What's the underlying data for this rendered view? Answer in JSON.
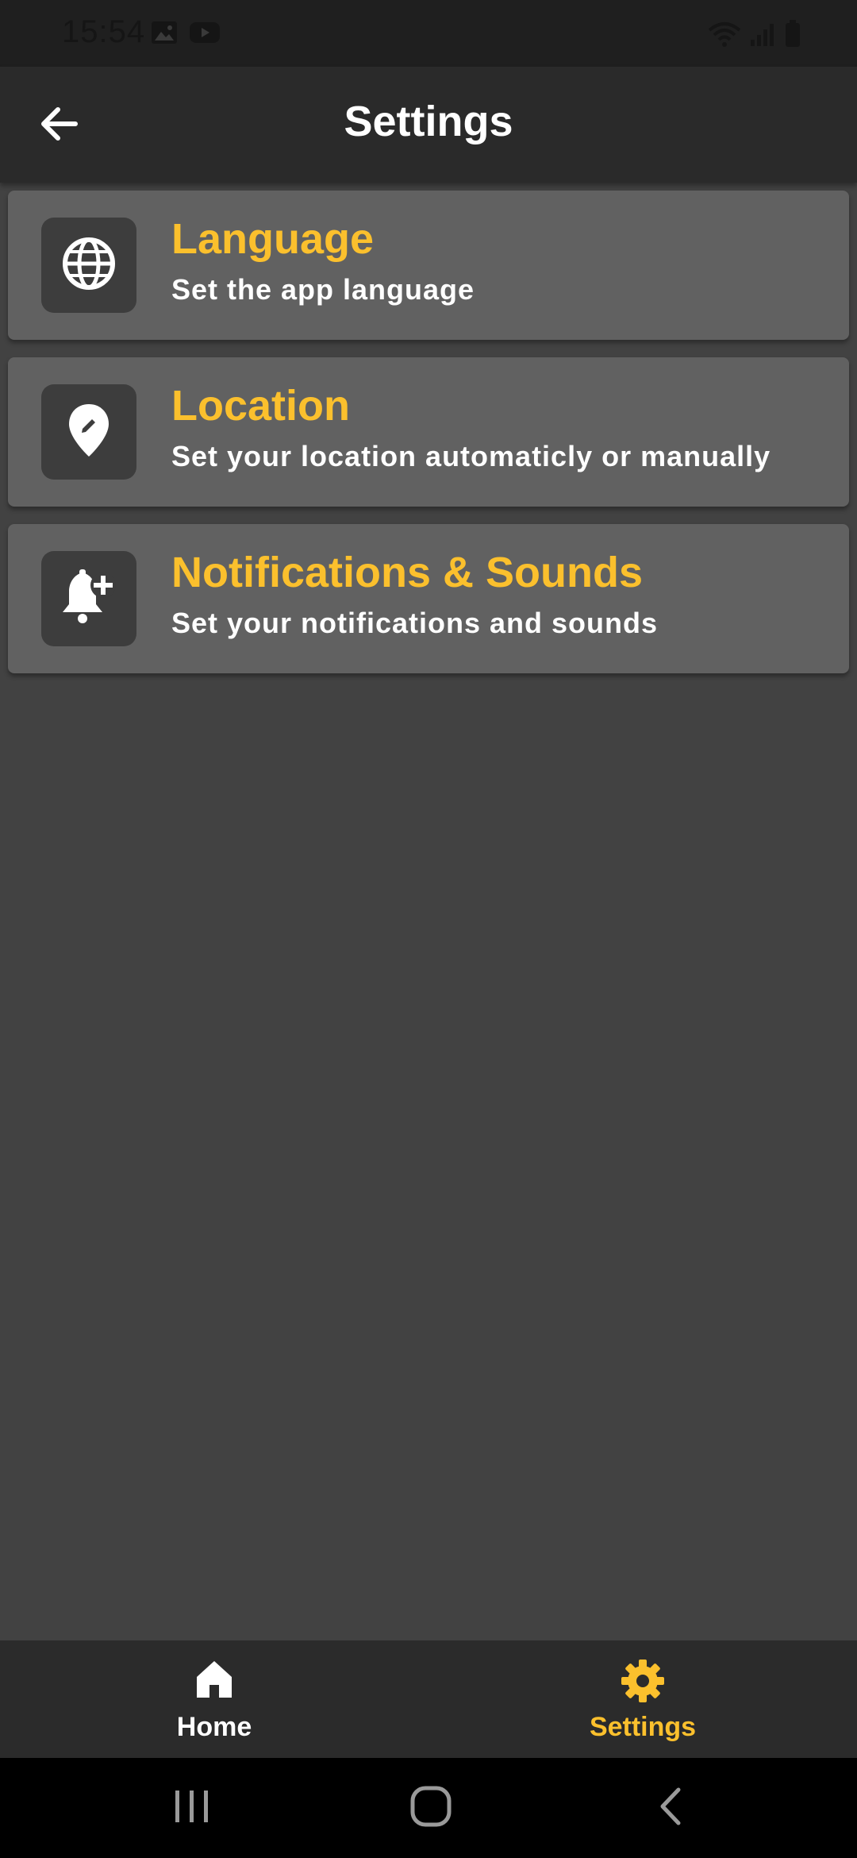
{
  "status_bar": {
    "time": "15:54",
    "icons": [
      "image-icon",
      "youtube-icon",
      "wifi-icon",
      "signal-icon",
      "battery-icon"
    ]
  },
  "app_bar": {
    "title": "Settings",
    "back_icon": "arrow-left-icon"
  },
  "settings": [
    {
      "title": "Language",
      "subtitle": "Set the app language",
      "icon": "globe-icon"
    },
    {
      "title": "Location",
      "subtitle": "Set your location automaticly or manually",
      "icon": "location-edit-icon"
    },
    {
      "title": "Notifications & Sounds",
      "subtitle": "Set your notifications and sounds",
      "icon": "bell-plus-icon"
    }
  ],
  "bottom_nav": {
    "items": [
      {
        "label": "Home",
        "icon": "home-icon",
        "active": false
      },
      {
        "label": "Settings",
        "icon": "gear-icon",
        "active": true
      }
    ]
  },
  "colors": {
    "accent": "#fbc02d",
    "background": "#424242",
    "card": "#616161",
    "app_bar": "#2a2a2a"
  },
  "system_nav": [
    "recents-icon",
    "home-circle-icon",
    "back-chevron-icon"
  ]
}
